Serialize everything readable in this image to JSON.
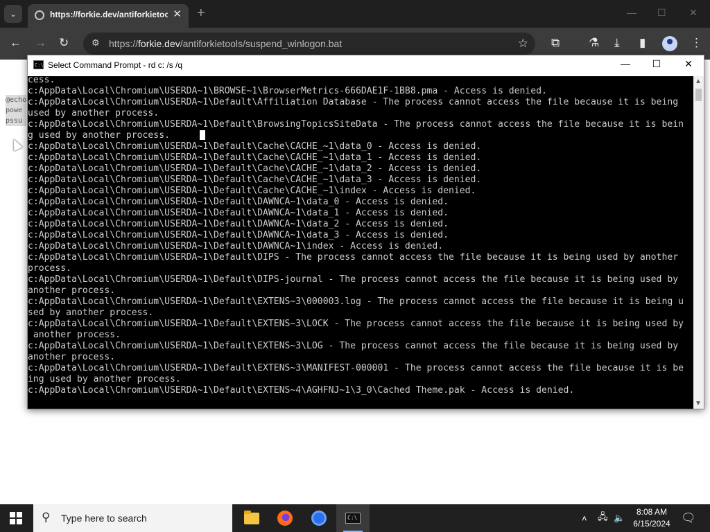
{
  "browser": {
    "tab_title": "https://forkie.dev/antiforkietools/suspend_winlogon.bat",
    "url_prefix": "https://",
    "url_host": "forkie.dev",
    "url_path": "/antiforkietools/suspend_winlogon.bat",
    "tab_close": "✕",
    "new_tab": "+"
  },
  "page": {
    "snippet_lines": [
      "@echo",
      "powe",
      "pssu"
    ]
  },
  "cmd": {
    "title": "Select Command Prompt - rd  c: /s /q",
    "icon_text": "C:\\",
    "lines": [
      "cess.",
      "c:AppData\\Local\\Chromium\\USERDA~1\\BROWSE~1\\BrowserMetrics-666DAE1F-1BB8.pma - Access is denied.",
      "c:AppData\\Local\\Chromium\\USERDA~1\\Default\\Affiliation Database - The process cannot access the file because it is being",
      "used by another process.",
      "c:AppData\\Local\\Chromium\\USERDA~1\\Default\\BrowsingTopicsSiteData - The process cannot access the file because it is bein",
      "g used by another process.",
      "c:AppData\\Local\\Chromium\\USERDA~1\\Default\\Cache\\CACHE_~1\\data_0 - Access is denied.",
      "c:AppData\\Local\\Chromium\\USERDA~1\\Default\\Cache\\CACHE_~1\\data_1 - Access is denied.",
      "c:AppData\\Local\\Chromium\\USERDA~1\\Default\\Cache\\CACHE_~1\\data_2 - Access is denied.",
      "c:AppData\\Local\\Chromium\\USERDA~1\\Default\\Cache\\CACHE_~1\\data_3 - Access is denied.",
      "c:AppData\\Local\\Chromium\\USERDA~1\\Default\\Cache\\CACHE_~1\\index - Access is denied.",
      "c:AppData\\Local\\Chromium\\USERDA~1\\Default\\DAWNCA~1\\data_0 - Access is denied.",
      "c:AppData\\Local\\Chromium\\USERDA~1\\Default\\DAWNCA~1\\data_1 - Access is denied.",
      "c:AppData\\Local\\Chromium\\USERDA~1\\Default\\DAWNCA~1\\data_2 - Access is denied.",
      "c:AppData\\Local\\Chromium\\USERDA~1\\Default\\DAWNCA~1\\data_3 - Access is denied.",
      "c:AppData\\Local\\Chromium\\USERDA~1\\Default\\DAWNCA~1\\index - Access is denied.",
      "c:AppData\\Local\\Chromium\\USERDA~1\\Default\\DIPS - The process cannot access the file because it is being used by another",
      "process.",
      "c:AppData\\Local\\Chromium\\USERDA~1\\Default\\DIPS-journal - The process cannot access the file because it is being used by",
      "another process.",
      "c:AppData\\Local\\Chromium\\USERDA~1\\Default\\EXTENS~3\\000003.log - The process cannot access the file because it is being u",
      "sed by another process.",
      "c:AppData\\Local\\Chromium\\USERDA~1\\Default\\EXTENS~3\\LOCK - The process cannot access the file because it is being used by",
      " another process.",
      "c:AppData\\Local\\Chromium\\USERDA~1\\Default\\EXTENS~3\\LOG - The process cannot access the file because it is being used by",
      "another process.",
      "c:AppData\\Local\\Chromium\\USERDA~1\\Default\\EXTENS~3\\MANIFEST-000001 - The process cannot access the file because it is be",
      "ing used by another process.",
      "c:AppData\\Local\\Chromium\\USERDA~1\\Default\\EXTENS~4\\AGHFNJ~1\\3_0\\Cached Theme.pak - Access is denied."
    ]
  },
  "taskbar": {
    "search_placeholder": "Type here to search",
    "time": "8:08 AM",
    "date": "6/15/2024"
  },
  "icons": {
    "chevron_down": "⌄",
    "back": "←",
    "forward": "→",
    "reload": "↻",
    "site_info": "⚙",
    "star": "☆",
    "extensions": "⧉",
    "labs": "⚗",
    "download": "⤓",
    "sidepanel": "▮",
    "menu": "⋮",
    "minimize": "—",
    "maximize": "☐",
    "close": "✕",
    "search": "⚲",
    "tray_up": "˄",
    "network": "🖧",
    "volume": "🔈",
    "notifications": "🗨",
    "scroll_up": "▲",
    "scroll_down": "▼"
  },
  "colors": {
    "console_bg": "#000000",
    "console_text": "#cccccc",
    "chrome_dark": "#1f1f1f",
    "taskbar": "#202020"
  }
}
